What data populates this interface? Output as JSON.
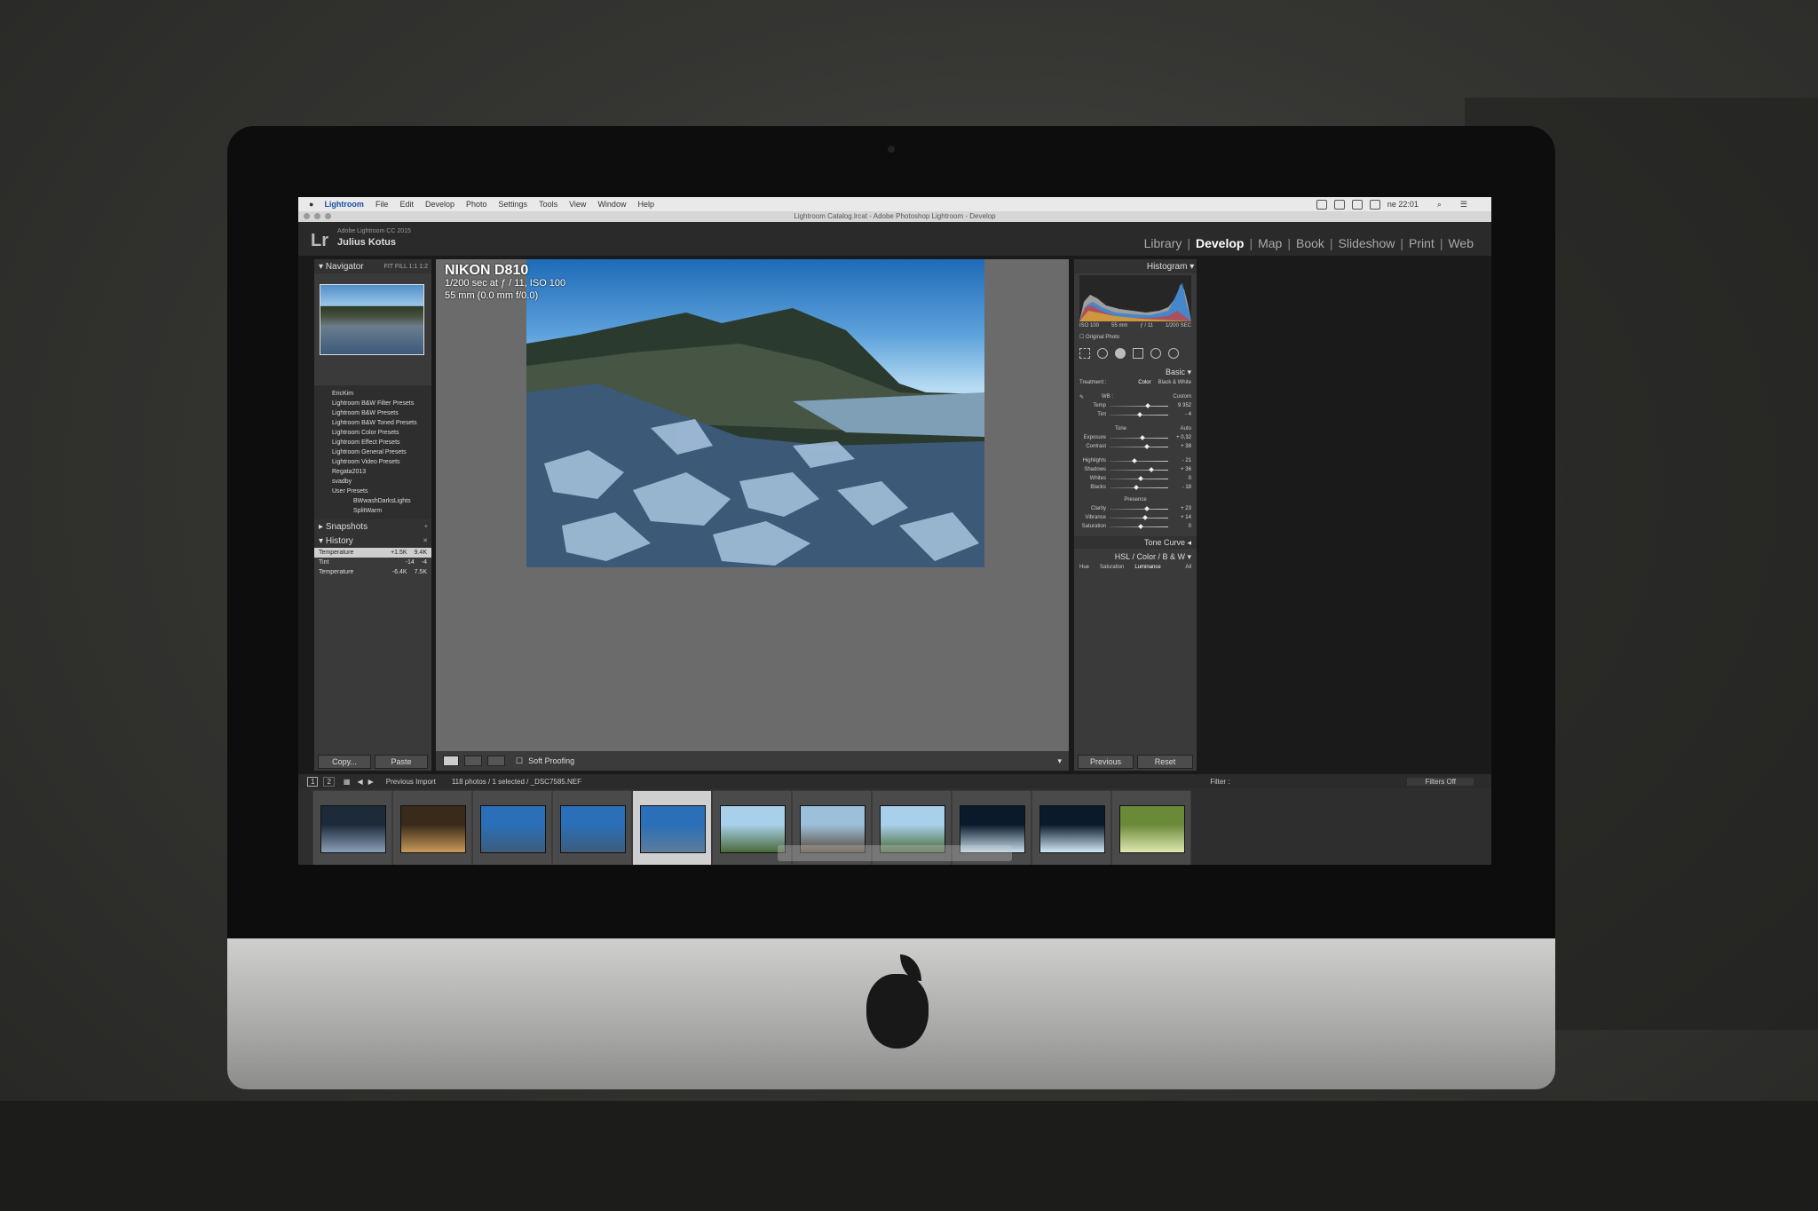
{
  "menubar": {
    "app": "Lightroom",
    "items": [
      "File",
      "Edit",
      "Develop",
      "Photo",
      "Settings",
      "Tools",
      "View",
      "Window",
      "Help"
    ],
    "clock": "ne 22:01"
  },
  "window_title": "Lightroom Catalog.lrcat - Adobe Photoshop Lightroom - Develop",
  "identity": {
    "logo": "Lr",
    "version": "Adobe Lightroom CC 2015",
    "user": "Julius Kotus"
  },
  "modules": [
    "Library",
    "Develop",
    "Map",
    "Book",
    "Slideshow",
    "Print",
    "Web"
  ],
  "left_panel": {
    "navigator_title": "Navigator",
    "navigator_zoom": "FIT  FILL  1:1  1:2",
    "presets": [
      {
        "label": "EricKim",
        "sub": false
      },
      {
        "label": "Lightroom B&W Filter Presets",
        "sub": false
      },
      {
        "label": "Lightroom B&W Presets",
        "sub": false
      },
      {
        "label": "Lightroom B&W Toned Presets",
        "sub": false
      },
      {
        "label": "Lightroom Color Presets",
        "sub": false
      },
      {
        "label": "Lightroom Effect Presets",
        "sub": false
      },
      {
        "label": "Lightroom General Presets",
        "sub": false
      },
      {
        "label": "Lightroom Video Presets",
        "sub": false
      },
      {
        "label": "Regata2013",
        "sub": false
      },
      {
        "label": "svadby",
        "sub": false
      },
      {
        "label": "User Presets",
        "sub": false
      },
      {
        "label": "BWwashDarksLights",
        "sub": true
      },
      {
        "label": "SplitWarm",
        "sub": true
      }
    ],
    "snapshots_title": "Snapshots",
    "history_title": "History",
    "history": [
      {
        "label": "Temperature",
        "a": "+1.5K",
        "b": "9.4K"
      },
      {
        "label": "Tint",
        "a": "-14",
        "b": "-4"
      },
      {
        "label": "Temperature",
        "a": "-6.4K",
        "b": "7.5K"
      }
    ],
    "copy_label": "Copy...",
    "paste_label": "Paste"
  },
  "photo_info": {
    "camera": "NIKON D810",
    "exposure": "1/200 sec at ƒ / 11, ISO 100",
    "lens": "55 mm (0.0 mm f/0.0)"
  },
  "toolbar": {
    "soft_proofing": "Soft Proofing"
  },
  "right_panel": {
    "histogram_title": "Histogram",
    "histogram_meta": [
      "ISO 100",
      "55 mm",
      "ƒ / 11",
      "1/200 SEC"
    ],
    "original_photo": "Original Photo",
    "basic_title": "Basic",
    "treatment_label": "Treatment :",
    "treatment_color": "Color",
    "treatment_bw": "Black & White",
    "wb_label": "WB :",
    "wb_value": "Custom",
    "wb_sliders": [
      {
        "label": "Temp",
        "value": "9 352",
        "pos": 0.62
      },
      {
        "label": "Tint",
        "value": "- 4",
        "pos": 0.48
      }
    ],
    "tone_label": "Tone",
    "auto_label": "Auto",
    "tone_sliders": [
      {
        "label": "Exposure",
        "value": "+ 0,32",
        "pos": 0.53
      },
      {
        "label": "Contrast",
        "value": "+ 38",
        "pos": 0.6
      }
    ],
    "tone_sliders2": [
      {
        "label": "Highlights",
        "value": "- 21",
        "pos": 0.4
      },
      {
        "label": "Shadows",
        "value": "+ 36",
        "pos": 0.68
      },
      {
        "label": "Whites",
        "value": "0",
        "pos": 0.5
      },
      {
        "label": "Blacks",
        "value": "- 18",
        "pos": 0.42
      }
    ],
    "presence_label": "Presence",
    "presence_sliders": [
      {
        "label": "Clarity",
        "value": "+ 23",
        "pos": 0.61
      },
      {
        "label": "Vibrance",
        "value": "+ 14",
        "pos": 0.57
      },
      {
        "label": "Saturation",
        "value": "0",
        "pos": 0.5
      }
    ],
    "tone_curve_title": "Tone Curve",
    "hsl_title": "HSL  /  Color  /  B & W",
    "hsl_tabs": [
      "Hue",
      "Saturation",
      "Luminance",
      "All"
    ],
    "previous_label": "Previous",
    "reset_label": "Reset"
  },
  "filmstrip": {
    "source": "Previous Import",
    "count": "118 photos / 1 selected / _DSC7585.NEF",
    "filter_label": "Filter :",
    "filters_off": "Filters Off",
    "thumbs": [
      {
        "c1": "#1d2a3a",
        "c2": "#8a9fb8"
      },
      {
        "c1": "#3a2a1a",
        "c2": "#c89a5a"
      },
      {
        "c1": "#2a6fb8",
        "c2": "#3d5c7a"
      },
      {
        "c1": "#2a6fb8",
        "c2": "#3d5c7a"
      },
      {
        "c1": "#2a6fb8",
        "c2": "#5c7c9a"
      },
      {
        "c1": "#a8d0ea",
        "c2": "#4a6a3a"
      },
      {
        "c1": "#9cc0da",
        "c2": "#5a4a3a"
      },
      {
        "c1": "#a8d0ea",
        "c2": "#4a6a3a"
      },
      {
        "c1": "#0a1a2a",
        "c2": "#c8e0f0"
      },
      {
        "c1": "#0a1a2a",
        "c2": "#d0e8f6"
      },
      {
        "c1": "#6a8a3a",
        "c2": "#e0e8b0"
      }
    ],
    "selected_index": 4
  }
}
